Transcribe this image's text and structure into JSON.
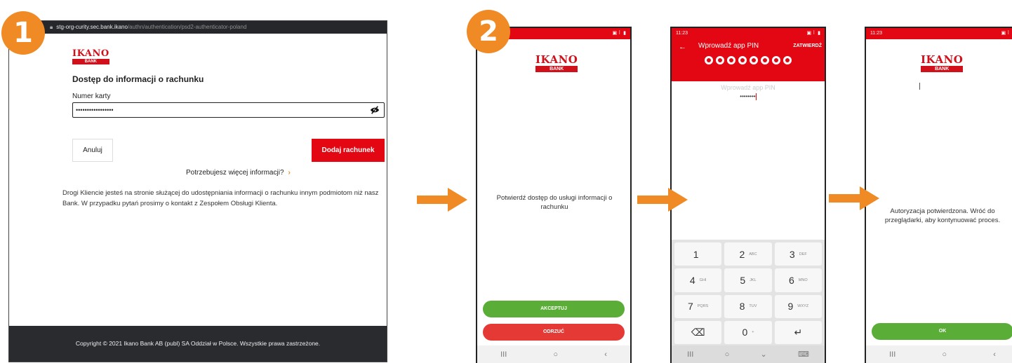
{
  "steps": {
    "one": "1",
    "two": "2"
  },
  "browser": {
    "url_host": "stg-org-curity.sec.bank.ikano",
    "url_path": "/authn/authentication/psd2-authenticator-poland",
    "logo_word": "IKANO",
    "logo_bank": "BANK",
    "heading": "Dostęp do informacji o rachunku",
    "field_label": "Numer karty",
    "field_value": "•••••••••••••••••",
    "cancel_label": "Anuluj",
    "add_label": "Dodaj rachunek",
    "more_info": "Potrzebujesz więcej informacji?",
    "info_text": "Drogi Kliencie jesteś na stronie służącej do udostępniania informacji o rachunku innym podmiotom niż nasz Bank. W przypadku pytań prosimy o kontakt z Zespołem Obsługi Klienta.",
    "footer": "Copyright © 2021 Ikano Bank AB (publ) SA Oddział w Polsce. Wszystkie prawa zastrzeżone."
  },
  "phone1": {
    "status_time": "",
    "logo_word": "IKANO",
    "logo_bank": "BANK",
    "message": "Potwierdź dostęp do usługi informacji o rachunku",
    "accept_label": "AKCEPTUJ",
    "reject_label": "ODRZUĆ"
  },
  "phone2": {
    "status_time": "11:23",
    "title": "Wprowadź app PIN",
    "confirm_label": "ZATWIERDŹ",
    "pin_placeholder": "Wprowadź app PIN",
    "pin_value": "••••••••",
    "keys": [
      {
        "digit": "1",
        "letters": ""
      },
      {
        "digit": "2",
        "letters": "ABC"
      },
      {
        "digit": "3",
        "letters": "DEF"
      },
      {
        "digit": "4",
        "letters": "GHI"
      },
      {
        "digit": "5",
        "letters": "JKL"
      },
      {
        "digit": "6",
        "letters": "MNO"
      },
      {
        "digit": "7",
        "letters": "PQRS"
      },
      {
        "digit": "8",
        "letters": "TUV"
      },
      {
        "digit": "9",
        "letters": "WXYZ"
      },
      {
        "digit": "⌫",
        "letters": ""
      },
      {
        "digit": "0",
        "letters": "+"
      },
      {
        "digit": "↵",
        "letters": ""
      }
    ]
  },
  "phone3": {
    "status_time": "11:23",
    "logo_word": "IKANO",
    "logo_bank": "BANK",
    "message": "Autoryzacja potwierdzona. Wróć do przeglądarki, aby kontynuować proces.",
    "ok_label": "OK"
  },
  "navbar": {
    "recent": "III",
    "home": "○",
    "back": "‹",
    "hide": "⌄",
    "keyboard": "⌨"
  },
  "colors": {
    "brand_red": "#e30613",
    "accent_orange": "#f08a24",
    "green": "#5aad36",
    "reject_red": "#e53935"
  },
  "icons": [
    "lock-icon",
    "eye-slash-icon",
    "chevron-right-icon",
    "arrow-right-icon",
    "back-arrow-icon",
    "backspace-icon",
    "enter-icon"
  ]
}
